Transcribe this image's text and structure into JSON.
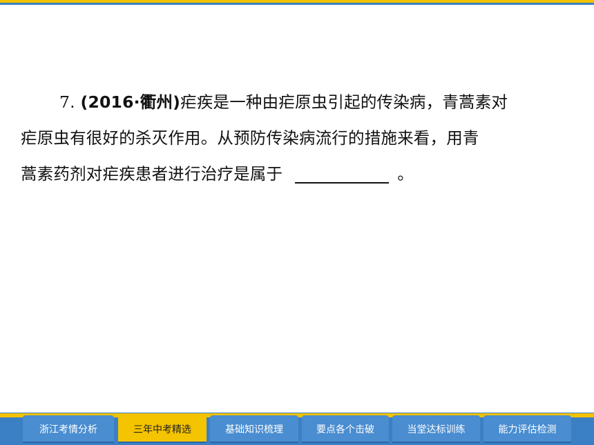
{
  "question": {
    "number": "7",
    "dot": ". ",
    "source": "(2016·衢州)",
    "line1_text": "疟疾是一种由疟原虫引起的传染病，青蒿素对",
    "line2_text": "疟原虫有很好的杀灭作用。从预防传染病流行的措施来看，用青",
    "line3_text": "蒿素药剂对疟疾患者进行治疗是属于",
    "ending": "。"
  },
  "nav": {
    "tabs": [
      {
        "label": "浙江考情分析"
      },
      {
        "label": "三年中考精选",
        "active": true
      },
      {
        "label": "基础知识梳理"
      },
      {
        "label": "要点各个击破"
      },
      {
        "label": "当堂达标训练"
      },
      {
        "label": "能力评估检测"
      }
    ]
  },
  "colors": {
    "blue": "#3b7fc4",
    "gold": "#f2c200"
  }
}
